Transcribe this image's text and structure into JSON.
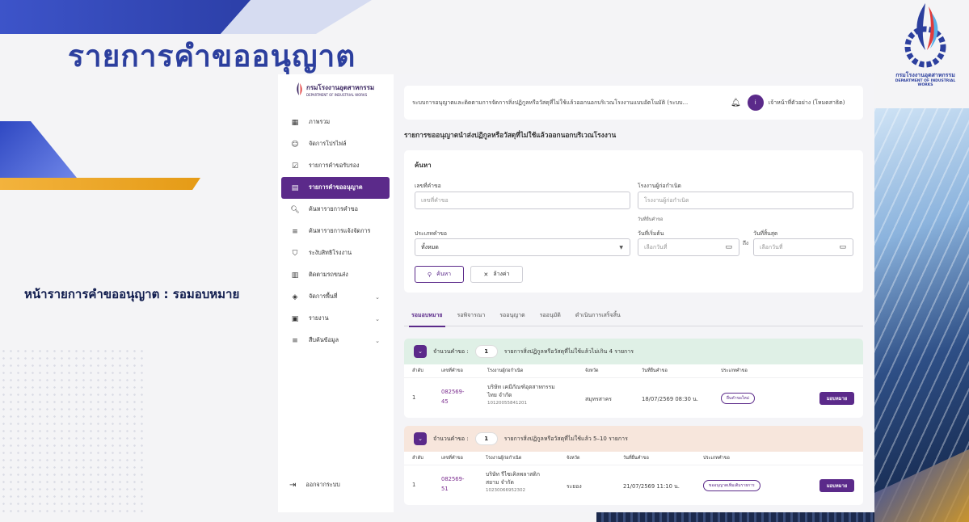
{
  "slide": {
    "title": "รายการคำขออนุญาต",
    "caption": "หน้ารายการคำขออนุญาต : รอมอบหมาย",
    "logo_text": "กรมโรงงานอุตสาหกรรม",
    "logo_subtext": "DEPARTMENT OF INDUSTRIAL WORKS"
  },
  "sidebar": {
    "logo_text": "กรมโรงงานอุตสาหกรรม",
    "logo_subtext": "DEPARTMENT OF INDUSTRIAL WORKS",
    "items": [
      {
        "label": "ภาพรวม",
        "icon": "grid-icon",
        "glyph": "▦"
      },
      {
        "label": "จัดการโปรไฟล์",
        "icon": "user-circle-icon",
        "glyph": "☺"
      },
      {
        "label": "รายการคำขอรับรอง",
        "icon": "checkbox-icon",
        "glyph": "☑"
      },
      {
        "label": "รายการคำขออนุญาต",
        "icon": "document-icon",
        "glyph": "▤"
      },
      {
        "label": "ค้นหารายการคำขอ",
        "icon": "doc-search-icon",
        "glyph": "🔍︎"
      },
      {
        "label": "ค้นหารายการแจ้งจัดการ",
        "icon": "list-search-icon",
        "glyph": "≡"
      },
      {
        "label": "ระงับสิทธิโรงงาน",
        "icon": "shield-icon",
        "glyph": "⛉"
      },
      {
        "label": "ติดตามรถขนส่ง",
        "icon": "map-icon",
        "glyph": "▥"
      },
      {
        "label": "จัดการพื้นที่",
        "icon": "layers-icon",
        "glyph": "◈"
      },
      {
        "label": "รายงาน",
        "icon": "report-icon",
        "glyph": "▣"
      },
      {
        "label": "สืบค้นข้อมูล",
        "icon": "list-search-icon",
        "glyph": "≡"
      }
    ],
    "logout_label": "ออกจากระบบ"
  },
  "topbar": {
    "system_name": "ระบบการอนุญาตและติดตามการจัดการสิ่งปฏิกูลหรือวัสดุที่ไม่ใช้แล้วออกนอกบริเวณโรงงานแบบอัตโนมัติ (ระบบ...",
    "avatar_initial": "i",
    "user_name": "เจ้าหน้าที่ตัวอย่าง (โหมดสาธิต)"
  },
  "page_title": "รายการขออนุญาตนำส่งปฏิกูลหรือวัสดุที่ไม่ใช้แล้วออกนอกบริเวณโรงงาน",
  "search": {
    "heading": "ค้นหา",
    "request_no_label": "เลขที่คำขอ",
    "request_no_placeholder": "เลขที่คำขอ",
    "factory_label": "โรงงานผู้ก่อกำเนิด",
    "factory_placeholder": "โรงงานผู้ก่อกำเนิด",
    "type_label": "ประเภทคำขอ",
    "type_value": "ทั้งหมด",
    "submit_date_label": "วันที่ยื่นคำขอ",
    "start_label": "วันที่เริ่มต้น",
    "start_placeholder": "เลือกวันที่",
    "to_label": "ถึง",
    "end_label": "วันที่สิ้นสุด",
    "end_placeholder": "เลือกวันที่",
    "search_button": "ค้นหา",
    "clear_button": "ล้างค่า"
  },
  "tabs": [
    "รอมอบหมาย",
    "รอพิจารณา",
    "รออนุญาต",
    "รออนุมัติ",
    "ดำเนินการเสร็จสิ้น"
  ],
  "columns": [
    "ลำดับ",
    "เลขที่คำขอ",
    "โรงงานผู้ก่อกำเนิด",
    "จังหวัด",
    "วันที่ยื่นคำขอ",
    "ประเภทคำขอ"
  ],
  "groups": [
    {
      "count_label": "จำนวนคำขอ :",
      "count": "1",
      "rule": "รายการสิ่งปฏิกูลหรือวัสดุที่ไม่ใช้แล้วไม่เกิน 4 รายการ",
      "header_color": "#dff0e6",
      "rows": [
        {
          "index": "1",
          "request_no_1": "082569-",
          "request_no_2": "45",
          "factory_1": "บริษัท เคมีภัณฑ์อุตสาหกรรม",
          "factory_2": "ไทย จำกัด",
          "factory_id": "10120055841201",
          "province": "สมุทรสาคร",
          "date": "18/07/2569 08:30 น.",
          "type": "ยื่นคำขอใหม่",
          "action": "มอบหมาย"
        }
      ]
    },
    {
      "count_label": "จำนวนคำขอ :",
      "count": "1",
      "rule": "รายการสิ่งปฏิกูลหรือวัสดุที่ไม่ใช้แล้ว 5–10 รายการ",
      "header_color": "#f7e6dc",
      "rows": [
        {
          "index": "1",
          "request_no_1": "082569-",
          "request_no_2": "51",
          "factory_1": "บริษัท รีไซเคิลพลาสติก",
          "factory_2": "สยาม จำกัด",
          "factory_id": "10230066952302",
          "province": "ระยอง",
          "date": "21/07/2569 11:10 น.",
          "type": "ขออนุญาตเพิ่มเติมรายการ",
          "action": "มอบหมาย"
        }
      ]
    }
  ],
  "colors": {
    "accent": "#5b2a8a",
    "brand_blue": "#2c3f9e",
    "gold": "#e9a92a"
  }
}
